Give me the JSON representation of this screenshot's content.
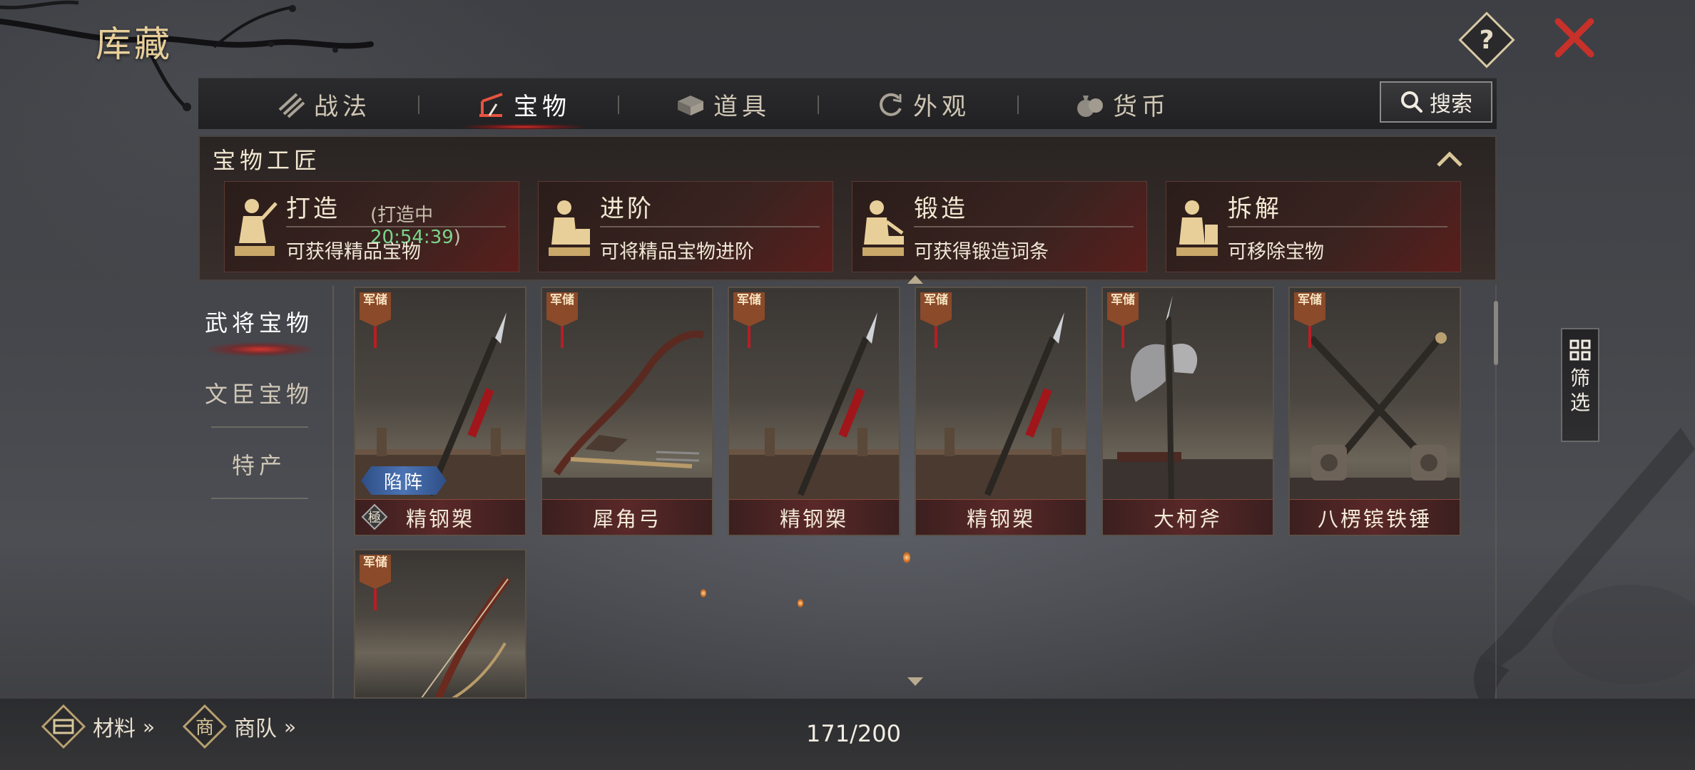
{
  "header": {
    "title": "库藏"
  },
  "tabs": [
    {
      "label": "战法",
      "icon": "scroll-bundle-icon",
      "active": false
    },
    {
      "label": "宝物",
      "icon": "weapon-rack-icon",
      "active": true
    },
    {
      "label": "道具",
      "icon": "chest-icon",
      "active": false
    },
    {
      "label": "外观",
      "icon": "swirl-icon",
      "active": false
    },
    {
      "label": "货币",
      "icon": "money-bag-icon",
      "active": false
    }
  ],
  "search": {
    "label": "搜索"
  },
  "craftsman": {
    "title": "宝物工匠",
    "cards": [
      {
        "name": "打造",
        "status_prefix": "(打造中",
        "timer": "20:54:39",
        "status_suffix": ")",
        "desc": "可获得精品宝物"
      },
      {
        "name": "进阶",
        "desc": "可将精品宝物进阶"
      },
      {
        "name": "锻造",
        "desc": "可获得锻造词条"
      },
      {
        "name": "拆解",
        "desc": "可移除宝物"
      }
    ]
  },
  "categories": [
    {
      "label": "武将宝物",
      "active": true
    },
    {
      "label": "文臣宝物",
      "active": false
    },
    {
      "label": "特产",
      "active": false
    }
  ],
  "items": [
    {
      "name": "精钢槊",
      "badge": "军储",
      "tag": "陷阵",
      "grade_mark": "極",
      "art": "spear"
    },
    {
      "name": "犀角弓",
      "badge": "军储",
      "art": "crossbow"
    },
    {
      "name": "精钢槊",
      "badge": "军储",
      "art": "spear"
    },
    {
      "name": "精钢槊",
      "badge": "军储",
      "art": "spear"
    },
    {
      "name": "大柯斧",
      "badge": "军储",
      "art": "axe"
    },
    {
      "name": "八楞镔铁锤",
      "badge": "军储",
      "art": "hammers"
    },
    {
      "name": "",
      "badge": "军储",
      "art": "bow"
    }
  ],
  "filter": {
    "label": "筛选"
  },
  "footer": {
    "materials_label": "材料",
    "caravan_label": "商队",
    "caravan_icon_char": "商",
    "more_arrows": "»",
    "capacity": "171/200"
  },
  "colors": {
    "accent_gold": "#e8cf9a",
    "active_red": "#d2302a",
    "timer_green": "#7ad68a",
    "tag_blue": "#4c74b4"
  }
}
